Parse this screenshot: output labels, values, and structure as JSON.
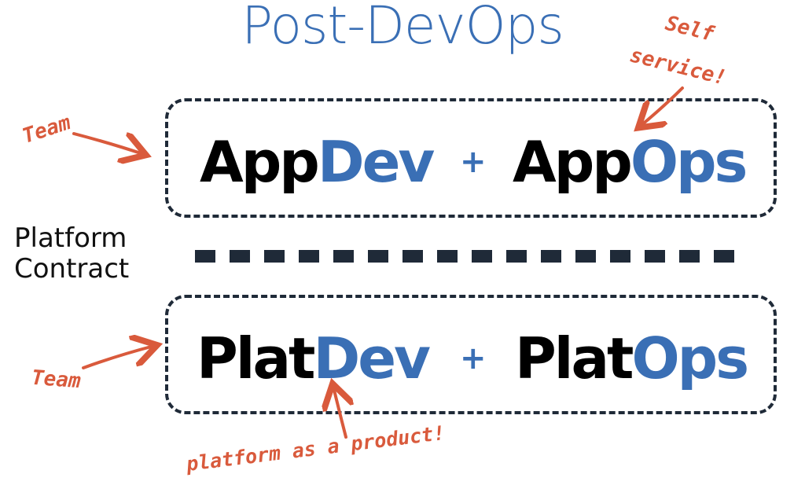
{
  "title": "Post-DevOps",
  "top_box": {
    "left_word": {
      "dark": "App",
      "blue": "Dev"
    },
    "plus": "+",
    "right_word": {
      "dark": "App",
      "blue": "Ops"
    }
  },
  "bottom_box": {
    "left_word": {
      "dark": "Plat",
      "blue": "Dev"
    },
    "plus": "+",
    "right_word": {
      "dark": "Plat",
      "blue": "Ops"
    }
  },
  "divider_label": {
    "line1": "Platform",
    "line2": "Contract"
  },
  "annotations": {
    "team_top": "Team",
    "team_bottom": "Team",
    "self_service_line1": "Self",
    "self_service_line2": "service!",
    "platform_product": "platform as a product!"
  },
  "colors": {
    "blue": "#3a6fb5",
    "dark": "#000000",
    "border": "#1f2a38",
    "annotation": "#d95a3c"
  }
}
